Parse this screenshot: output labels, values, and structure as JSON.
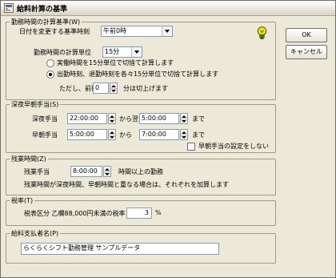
{
  "window": {
    "title": "給料計算の基準",
    "icon": "app-window-icon"
  },
  "calc_basis": {
    "legend": "勤務時間の計算基準(W)",
    "date_change_label": "日付を変更する基準時刻",
    "date_change_value": "午前0時",
    "unit_label": "勤務時間の計算単位",
    "unit_value": "15分",
    "radio1_label": "実働時間を15分単位で切捨て計算します",
    "radio1_selected": false,
    "radio2_label": "出勤時刻、退勤時刻を各々15分単位で切捨て計算します",
    "radio2_selected": true,
    "round_prefix": "ただし、前後",
    "round_value": "0",
    "round_suffix": "分は切上げます"
  },
  "night_early": {
    "legend": "深夜早朝手当(S)",
    "night_label": "深夜手当",
    "night_from": "22:00:00",
    "night_mid": "から翌",
    "night_to": "5:00:00",
    "night_suffix": "まで",
    "early_label": "早朝手当",
    "early_from": "5:00:00",
    "early_mid": "から",
    "early_to": "7:00:00",
    "early_suffix": "まで",
    "no_early_label": "早朝手当の設定をしない",
    "no_early_checked": false
  },
  "overtime": {
    "legend": "残業時間(Z)",
    "label": "残業手当",
    "value": "8:00:00",
    "suffix": "時間以上の勤務",
    "note": "残業時間が深夜時間、早朝時間と重なる場合は、それぞれを加算します"
  },
  "tax": {
    "legend": "税率(T)",
    "label": "税表区分 乙欄88,000円未満の税率",
    "value": "3",
    "unit": "%"
  },
  "payer": {
    "legend": "給料支払者名(P)",
    "value": "らくらくシフト勤務管理 サンプルデータ"
  },
  "buttons": {
    "ok": "OK",
    "cancel": "キャンセル"
  },
  "help_icon": "hint-bulb-icon"
}
